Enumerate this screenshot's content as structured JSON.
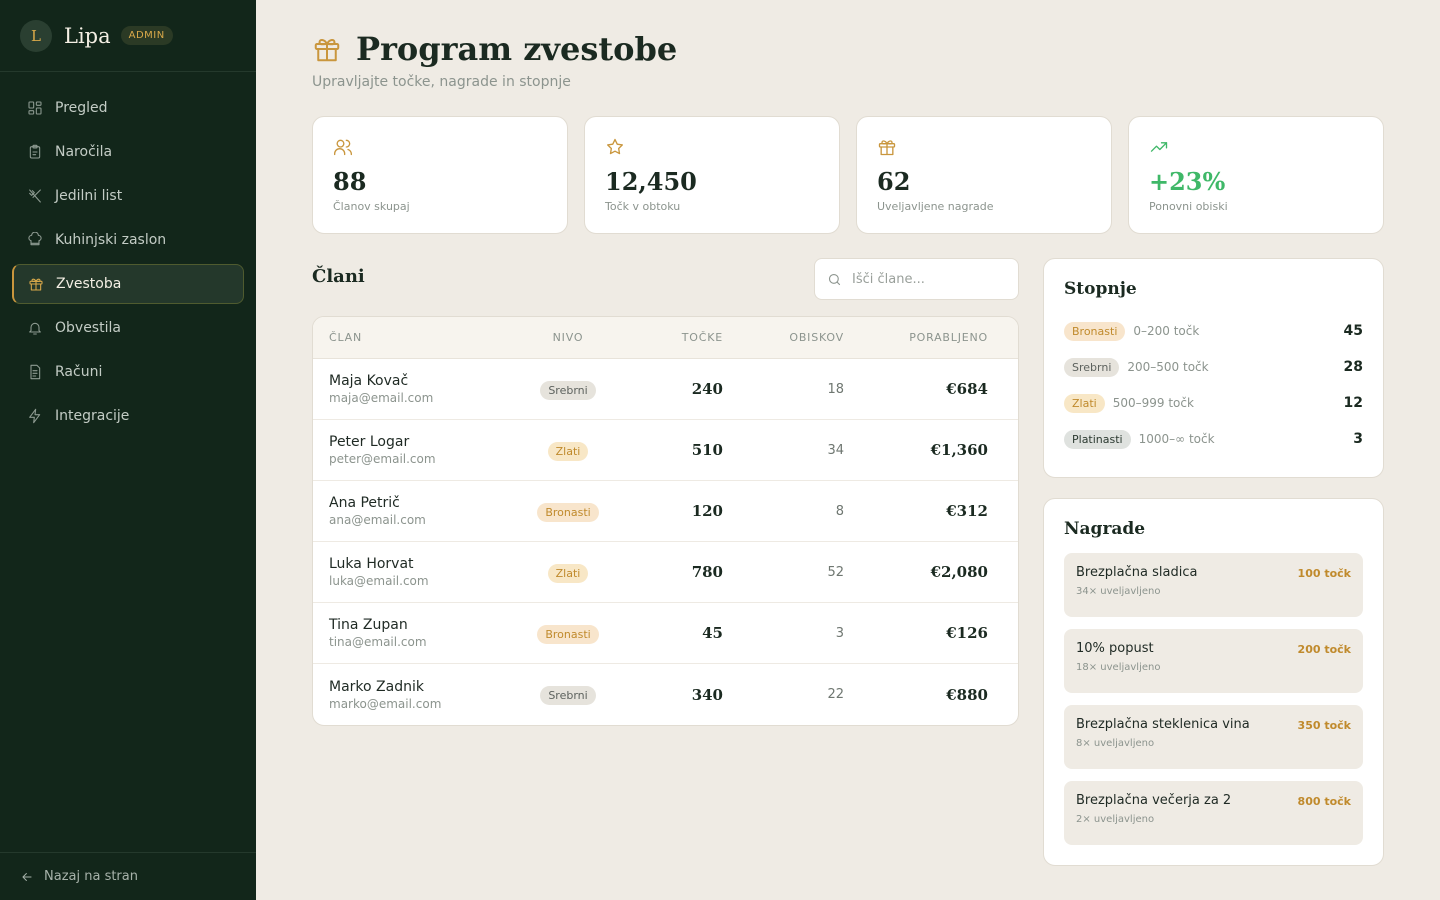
{
  "brand": {
    "initial": "L",
    "name": "Lipa",
    "badge": "ADMIN"
  },
  "nav": [
    {
      "label": "Pregled",
      "icon": "grid-icon"
    },
    {
      "label": "Naročila",
      "icon": "clipboard-icon"
    },
    {
      "label": "Jedilni list",
      "icon": "utensils-icon"
    },
    {
      "label": "Kuhinjski zaslon",
      "icon": "chef-hat-icon"
    },
    {
      "label": "Zvestoba",
      "icon": "gift-icon",
      "active": true
    },
    {
      "label": "Obvestila",
      "icon": "bell-icon"
    },
    {
      "label": "Računi",
      "icon": "receipt-icon"
    },
    {
      "label": "Integracije",
      "icon": "zap-icon"
    }
  ],
  "footer": {
    "back_label": "Nazaj na stran"
  },
  "page": {
    "title": "Program zvestobe",
    "subtitle": "Upravljajte točke, nagrade in stopnje"
  },
  "stats": [
    {
      "value": "88",
      "label": "Članov skupaj",
      "icon": "users-icon"
    },
    {
      "value": "12,450",
      "label": "Točk v obtoku",
      "icon": "star-icon"
    },
    {
      "value": "62",
      "label": "Uveljavljene nagrade",
      "icon": "gift-icon"
    },
    {
      "value": "+23%",
      "label": "Ponovni obiski",
      "icon": "trending-up-icon",
      "color": "#3fb868"
    }
  ],
  "members": {
    "title": "Člani",
    "search_placeholder": "Išči člane...",
    "columns": [
      "ČLAN",
      "NIVO",
      "TOČKE",
      "OBISKOV",
      "PORABLJENO"
    ],
    "rows": [
      {
        "name": "Maja Kovač",
        "email": "maja@email.com",
        "tier": "Srebrni",
        "points": "240",
        "visits": "18",
        "spent": "€684"
      },
      {
        "name": "Peter Logar",
        "email": "peter@email.com",
        "tier": "Zlati",
        "points": "510",
        "visits": "34",
        "spent": "€1,360"
      },
      {
        "name": "Ana Petrič",
        "email": "ana@email.com",
        "tier": "Bronasti",
        "points": "120",
        "visits": "8",
        "spent": "€312"
      },
      {
        "name": "Luka Horvat",
        "email": "luka@email.com",
        "tier": "Zlati",
        "points": "780",
        "visits": "52",
        "spent": "€2,080"
      },
      {
        "name": "Tina Zupan",
        "email": "tina@email.com",
        "tier": "Bronasti",
        "points": "45",
        "visits": "3",
        "spent": "€126"
      },
      {
        "name": "Marko Zadnik",
        "email": "marko@email.com",
        "tier": "Srebrni",
        "points": "340",
        "visits": "22",
        "spent": "€880"
      }
    ]
  },
  "tiers": {
    "title": "Stopnje",
    "items": [
      {
        "name": "Bronasti",
        "range": "0–200 točk",
        "count": "45"
      },
      {
        "name": "Srebrni",
        "range": "200–500 točk",
        "count": "28"
      },
      {
        "name": "Zlati",
        "range": "500–999 točk",
        "count": "12"
      },
      {
        "name": "Platinasti",
        "range": "1000–∞ točk",
        "count": "3"
      }
    ]
  },
  "rewards": {
    "title": "Nagrade",
    "items": [
      {
        "name": "Brezplačna sladica",
        "points": "100 točk",
        "used": "34× uveljavljeno"
      },
      {
        "name": "10% popust",
        "points": "200 točk",
        "used": "18× uveljavljeno"
      },
      {
        "name": "Brezplačna steklenica vina",
        "points": "350 točk",
        "used": "8× uveljavljeno"
      },
      {
        "name": "Brezplačna večerja za 2",
        "points": "800 točk",
        "used": "2× uveljavljeno"
      }
    ]
  },
  "colors": {
    "sidebar": "#12261a",
    "accent": "#c9963d",
    "positive": "#3fb868",
    "background": "#efebe4"
  }
}
